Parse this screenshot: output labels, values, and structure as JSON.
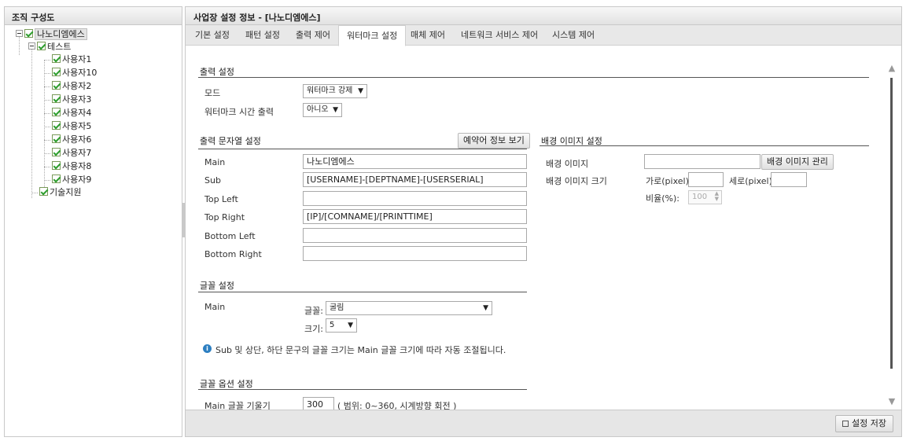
{
  "left_panel": {
    "title": "조직 구성도",
    "tree": {
      "root": "나노디엠에스",
      "group": "테스트",
      "users": [
        "사용자1",
        "사용자10",
        "사용자2",
        "사용자3",
        "사용자4",
        "사용자5",
        "사용자6",
        "사용자7",
        "사용자8",
        "사용자9"
      ],
      "other": "기술지원"
    }
  },
  "right_panel": {
    "title": "사업장 설정 정보 - [나노디엠에스]",
    "tabs": [
      "기본 설정",
      "패턴 설정",
      "출력 제어",
      "워터마크 설정",
      "매체 제어",
      "네트워크 서비스 제어",
      "시스템 제어"
    ],
    "active_tab": "워터마크 설정"
  },
  "output_settings": {
    "title": "출력 설정",
    "mode_label": "모드",
    "mode_value": "워터마크 강제",
    "time_label": "워터마크 시간 출력",
    "time_value": "아니오"
  },
  "string_settings": {
    "title": "출력 문자열 설정",
    "reserved_button": "예약어 정보 보기",
    "fields": [
      {
        "label": "Main",
        "value": "나노디엠에스"
      },
      {
        "label": "Sub",
        "value": "[USERNAME]-[DEPTNAME]-[USERSERIAL]"
      },
      {
        "label": "Top Left",
        "value": ""
      },
      {
        "label": "Top Right",
        "value": "[IP]/[COMNAME]/[PRINTTIME]"
      },
      {
        "label": "Bottom Left",
        "value": ""
      },
      {
        "label": "Bottom Right",
        "value": ""
      }
    ]
  },
  "bg_settings": {
    "title": "배경 이미지 설정",
    "image_label": "배경 이미지",
    "manage_button": "배경 이미지 관리",
    "size_label": "배경 이미지 크기",
    "width_label": "가로(pixel):",
    "height_label": "세로(pixel):",
    "ratio_label": "비율(%):",
    "ratio_value": "100"
  },
  "font_settings": {
    "title": "글꼴 설정",
    "main_label": "Main",
    "font_label": "글꼴:",
    "font_value": "굴림",
    "size_label": "크기:",
    "size_value": "5",
    "info_text": "Sub 및 상단, 하단 문구의 글꼴 크기는 Main 글꼴 크기에 따라 자동 조절됩니다."
  },
  "font_option_settings": {
    "title": "글꼴 옵션 설정",
    "tilt_label": "Main 글꼴 기울기",
    "tilt_value": "300",
    "tilt_hint": "( 범위: 0~360, 시계방향 회전 )"
  },
  "footer": {
    "save_button": "설정 저장"
  }
}
